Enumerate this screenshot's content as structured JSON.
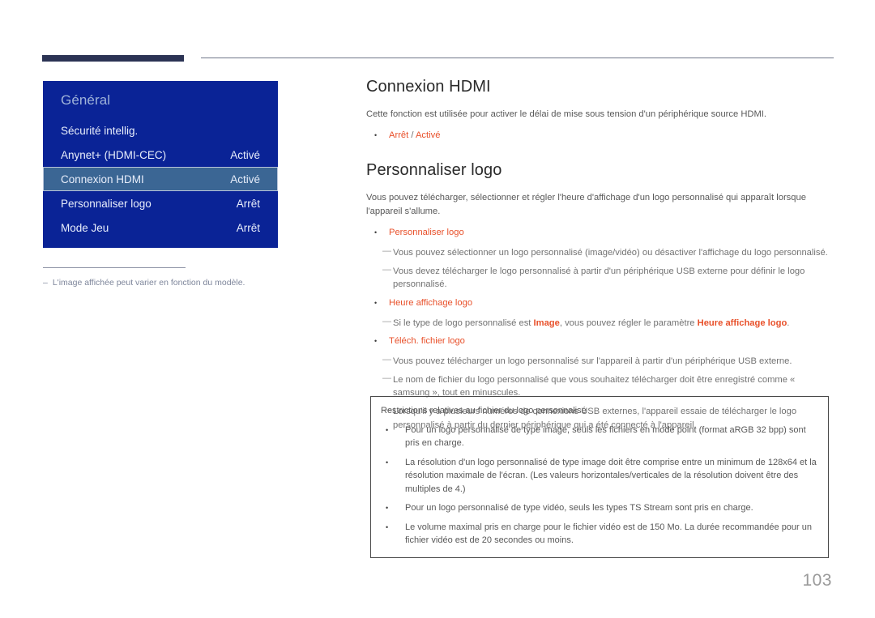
{
  "colors": {
    "accent_red": "#e8502a",
    "osd_blue": "#0a2396",
    "osd_selected": "#3b6694",
    "header_bar": "#2b3354",
    "note_gray_blue": "#7e869b"
  },
  "header": {
    "thick_bar": "",
    "thin_rule": ""
  },
  "osd": {
    "title": "Général",
    "rows": [
      {
        "label": "Sécurité intellig.",
        "value": "",
        "selected": false
      },
      {
        "label": "Anynet+ (HDMI-CEC)",
        "value": "Activé",
        "selected": false
      },
      {
        "label": "Connexion HDMI",
        "value": "Activé",
        "selected": true
      },
      {
        "label": "Personnaliser logo",
        "value": "Arrêt",
        "selected": false
      },
      {
        "label": "Mode Jeu",
        "value": "Arrêt",
        "selected": false
      }
    ]
  },
  "left_note": {
    "dash": "‒",
    "text": "L'image affichée peut varier en fonction du modèle."
  },
  "content": {
    "section1": {
      "title": "Connexion HDMI",
      "paragraph": "Cette fonction est utilisée pour activer le délai de mise sous tension d'un périphérique source HDMI.",
      "bullet_dot": "•",
      "bullet_option_a": "Arrêt",
      "bullet_separator": " / ",
      "bullet_option_b": "Activé"
    },
    "section2": {
      "title": "Personnaliser logo",
      "paragraph": "Vous pouvez télécharger, sélectionner et régler l'heure d'affichage d'un logo personnalisé qui apparaît lorsque l'appareil s'allume.",
      "items": [
        {
          "bullet": "Personnaliser logo",
          "notes": [
            {
              "pre": "Vous pouvez sélectionner un logo personnalisé (image/vidéo) ou désactiver l'affichage du logo personnalisé.",
              "em": "",
              "post": ""
            },
            {
              "pre": "Vous devez télécharger le logo personnalisé à partir d'un périphérique USB externe pour définir le logo personnalisé.",
              "em": "",
              "post": ""
            }
          ]
        },
        {
          "bullet": "Heure affichage logo",
          "notes": [
            {
              "pre": "Si le type de logo personnalisé est ",
              "em": "Image",
              "post": ", vous pouvez régler le paramètre ",
              "em2": "Heure affichage logo",
              "post2": "."
            }
          ]
        },
        {
          "bullet": "Téléch. fichier logo",
          "notes": [
            {
              "pre": "Vous pouvez télécharger un logo personnalisé sur l'appareil à partir d'un périphérique USB externe.",
              "em": "",
              "post": ""
            },
            {
              "pre": "Le nom de fichier du logo personnalisé que vous souhaitez télécharger doit être enregistré comme « samsung », tout en minuscules.",
              "em": "",
              "post": ""
            },
            {
              "pre": "Lorsqu'il y a plusieurs numéros de connexions USB externes, l'appareil essaie de télécharger le logo personnalisé à partir du dernier périphérique qui a été connecté à l'appareil.",
              "em": "",
              "post": ""
            }
          ]
        }
      ],
      "dash_mark": "―"
    }
  },
  "restrictions": {
    "title": "Restrictions relatives au fichier du logo personnalisé",
    "bullet": "•",
    "items": [
      "Pour un logo personnalisé de type image, seuls les fichiers en mode point (format aRGB 32 bpp) sont pris en charge.",
      "La résolution d'un logo personnalisé de type image doit être comprise entre un minimum de 128x64 et la résolution maximale de l'écran. (Les valeurs horizontales/verticales de la résolution doivent être des multiples de 4.)",
      "Pour un logo personnalisé de type vidéo, seuls les types TS Stream sont pris en charge.",
      "Le volume maximal pris en charge pour le fichier vidéo est de 150 Mo. La durée recommandée pour un fichier vidéo est de 20 secondes ou moins."
    ]
  },
  "page_number": "103"
}
